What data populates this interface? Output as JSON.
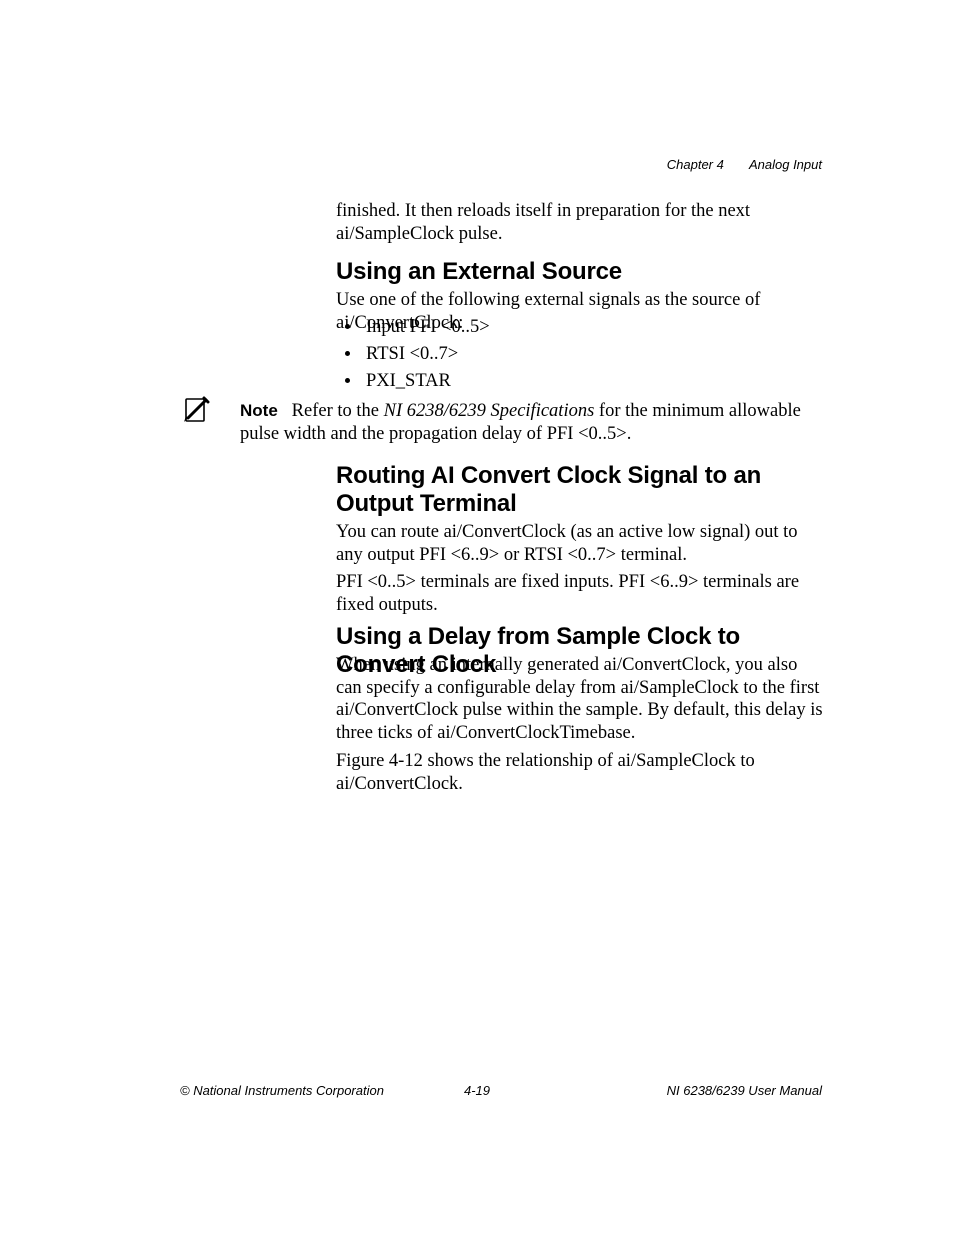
{
  "header": {
    "chapter": "Chapter 4",
    "title": "Analog Input"
  },
  "intro_para": "finished. It then reloads itself in preparation for the next ai/SampleClock pulse.",
  "section_a": {
    "heading": "Using an External Source",
    "para": "Use one of the following external signals as the source of ai/ConvertClock:",
    "bullets": [
      "Input PFI <0..5>",
      "RTSI <0..7>",
      "PXI_STAR"
    ]
  },
  "note": {
    "label": "Note",
    "before_italic": "Refer to the ",
    "italic": "NI 6238/6239 Specifications",
    "after_italic": " for the minimum allowable pulse width and the propagation delay of PFI <0..5>."
  },
  "section_b": {
    "heading": "Routing AI Convert Clock Signal to an Output Terminal",
    "para1": "You can route ai/ConvertClock (as an active low signal) out to any output PFI <6..9> or RTSI <0..7> terminal.",
    "para2": "PFI <0..5> terminals are fixed inputs. PFI <6..9> terminals are fixed outputs."
  },
  "section_c": {
    "heading": "Using a Delay from Sample Clock to Convert Clock",
    "para1": "When using an internally generated ai/ConvertClock, you also can specify a configurable delay from ai/SampleClock to the first ai/ConvertClock pulse within the sample. By default, this delay is three ticks of ai/ConvertClockTimebase.",
    "para2": "Figure 4-12 shows the relationship of ai/SampleClock to ai/ConvertClock."
  },
  "footer": {
    "left": "© National Instruments Corporation",
    "center": "4-19",
    "right": "NI 6238/6239 User Manual"
  }
}
